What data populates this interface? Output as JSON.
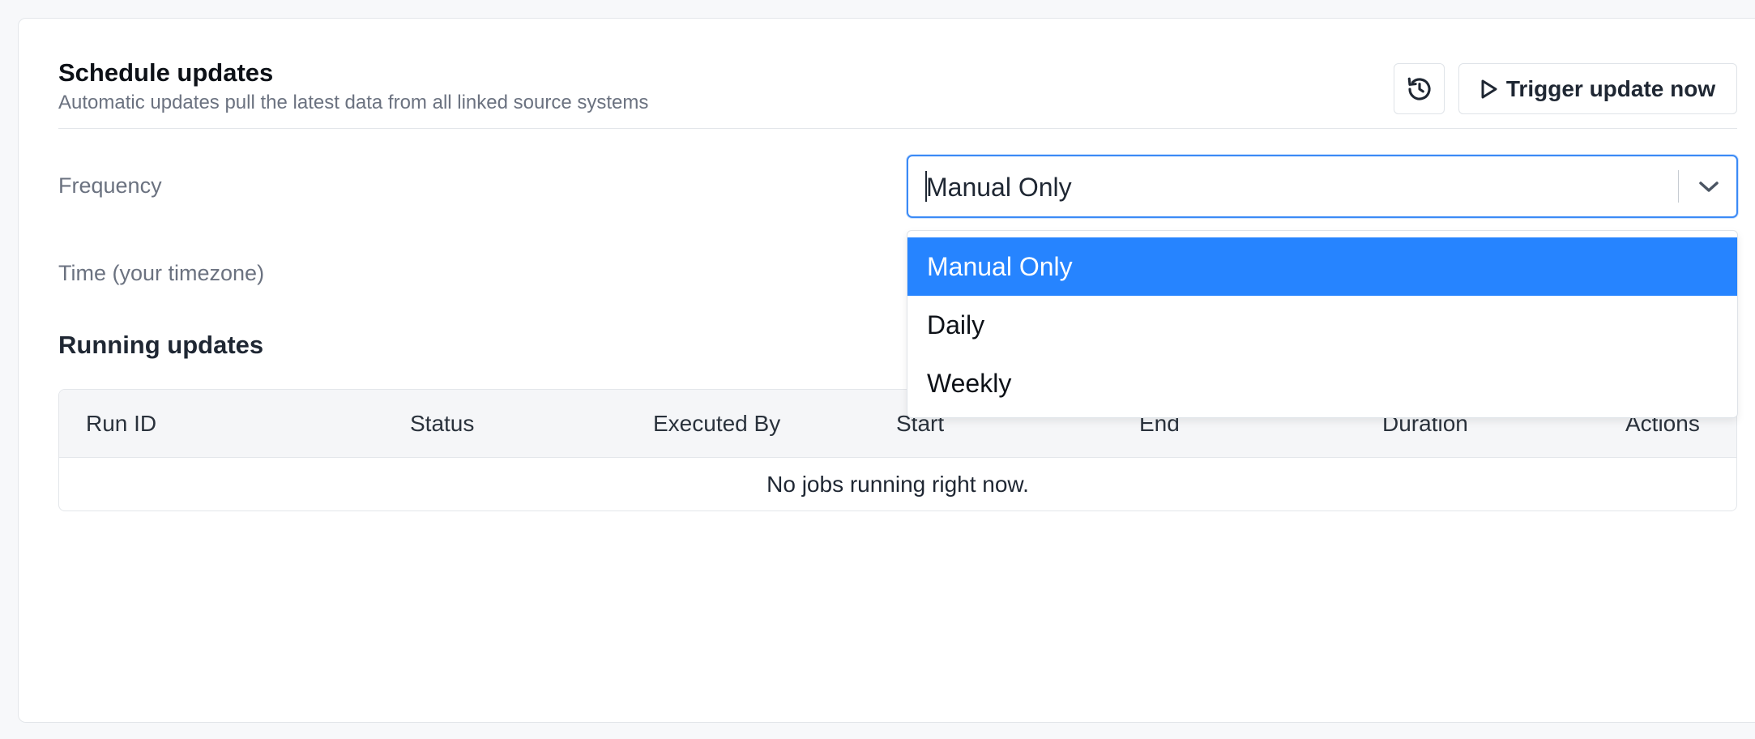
{
  "schedule": {
    "title": "Schedule updates",
    "subtitle": "Automatic updates pull the latest data from all linked source systems",
    "history_icon": "history-icon",
    "trigger_label": "Trigger update now",
    "trigger_icon": "play-icon"
  },
  "form": {
    "frequency_label": "Frequency",
    "frequency_value": "Manual Only",
    "time_label": "Time (your timezone)",
    "options": [
      "Manual Only",
      "Daily",
      "Weekly"
    ],
    "selected_option": "Manual Only"
  },
  "running": {
    "title": "Running updates",
    "columns": [
      "Run ID",
      "Status",
      "Executed By",
      "Start",
      "End",
      "Duration",
      "Actions"
    ],
    "empty_message": "No jobs running right now."
  },
  "colors": {
    "accent": "#2684ff",
    "focus_border": "#3b8af6"
  }
}
